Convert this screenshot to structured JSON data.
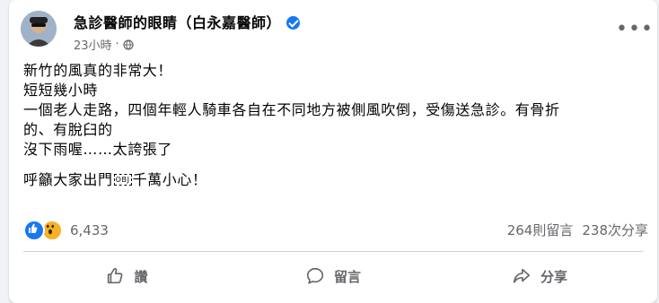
{
  "post": {
    "author": "急診醫師的眼睛（白永嘉醫師）",
    "time": "23小時",
    "separator": "·",
    "privacy_icon": "globe-icon",
    "more_icon": "more-options-icon",
    "more_label": "•••",
    "lines": [
      "新竹的風真的非常大！",
      "短短幾小時",
      "一個老人走路，四個年輕人騎車各自在不同地方被側風吹倒，受傷送急診。有骨折",
      "的、有脫臼的",
      "沒下雨喔……太誇張了"
    ],
    "closing_before": "呼籲大家出門",
    "closing_obj": "OBJ",
    "closing_after": "千萬小心！"
  },
  "reactions": {
    "icons": [
      "like-reaction-icon",
      "wow-reaction-icon"
    ],
    "count": "6,433"
  },
  "stats": {
    "comments": "264則留言",
    "shares": "238次分享"
  },
  "actions": {
    "like": "讚",
    "comment": "留言",
    "share": "分享"
  },
  "colors": {
    "accent": "#1877f2",
    "secondary_text": "#65676b",
    "background": "#f0f2f5"
  }
}
